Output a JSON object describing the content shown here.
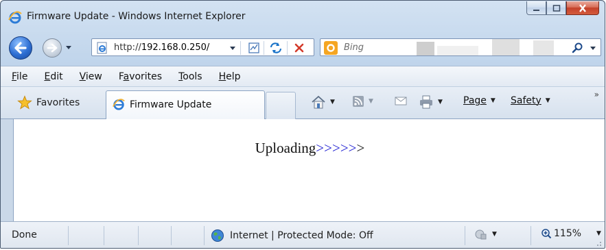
{
  "window": {
    "title": "Firmware Update - Windows Internet Explorer",
    "accent": "#2e6fd3",
    "close_color": "#c4412a"
  },
  "address": {
    "url_prefix": "http://",
    "url_host": "192.168.0.250/",
    "search_placeholder": "Bing"
  },
  "menu": {
    "items": [
      "File",
      "Edit",
      "View",
      "Favorites",
      "Tools",
      "Help"
    ],
    "access_keys": [
      "F",
      "E",
      "V",
      "a",
      "T",
      "H"
    ]
  },
  "favbar": {
    "favorites_label": "Favorites",
    "tab_label": "Firmware Update",
    "page_label": "Page",
    "safety_label": "Safety",
    "overflow": "»"
  },
  "content": {
    "message": "Uploading",
    "arrows": ">>>>>",
    "trailing": ">",
    "arrow_color": "#1c1cd1"
  },
  "status": {
    "text": "Done",
    "zone": "Internet | Protected Mode: Off",
    "zoom": "115%"
  },
  "icons": [
    "ie-logo-icon",
    "minimize-icon",
    "maximize-icon",
    "close-icon",
    "back-arrow-icon",
    "forward-arrow-icon",
    "compatibility-icon",
    "refresh-icon",
    "stop-icon",
    "bing-icon",
    "search-icon",
    "star-icon",
    "home-icon",
    "feeds-icon",
    "read-mail-icon",
    "print-icon",
    "globe-icon",
    "addon-icon",
    "zoom-icon"
  ]
}
